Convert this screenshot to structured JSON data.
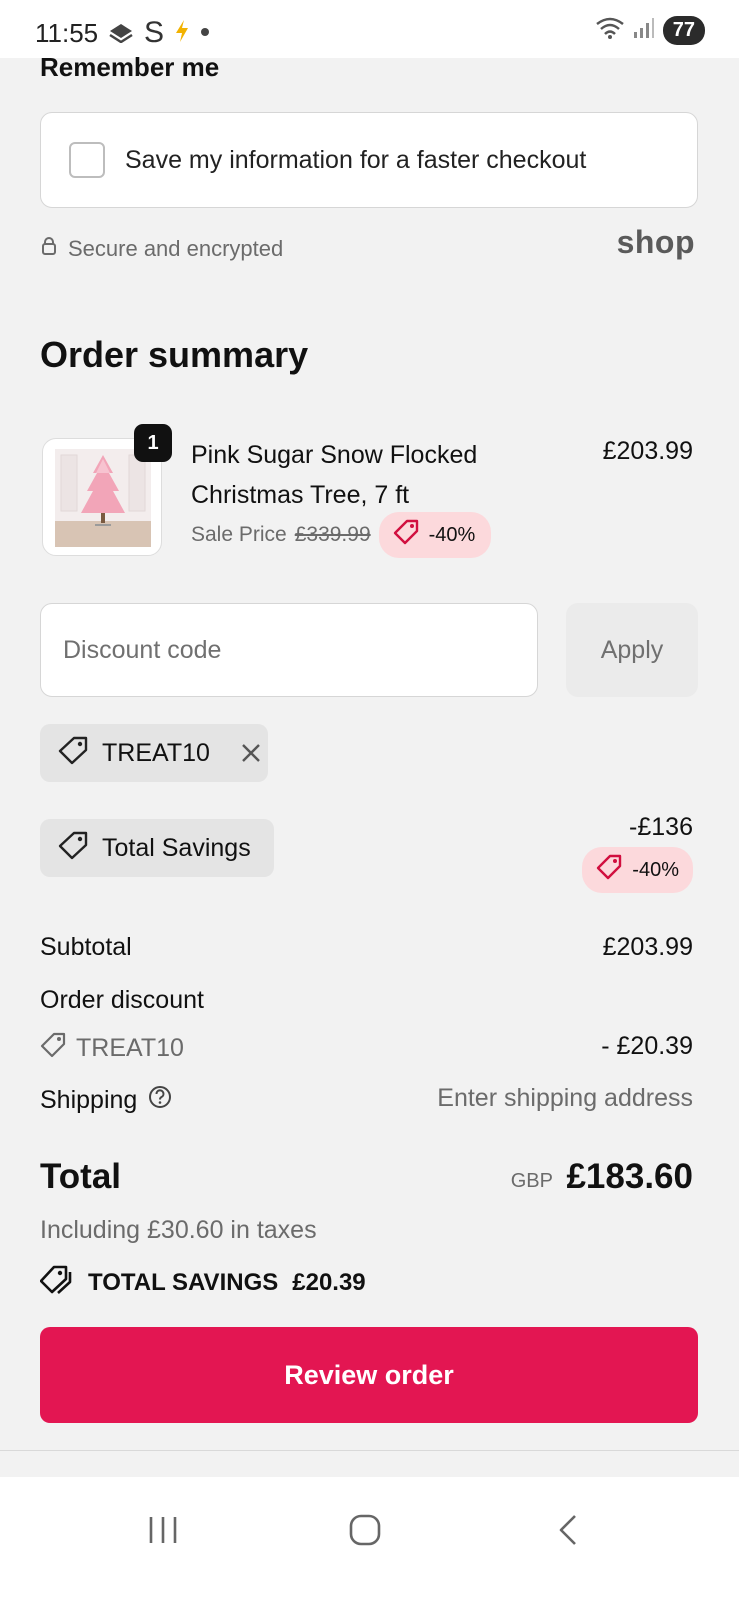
{
  "status_bar": {
    "time": "11:55",
    "s_glyph": "S",
    "battery": "77",
    "left_icons": [
      "stack-icon",
      "s-app-icon",
      "bolt-icon",
      "dot-icon"
    ],
    "right_icons": [
      "wifi-icon",
      "signal-icon",
      "battery-icon"
    ]
  },
  "remember": {
    "title": "Remember me",
    "checkbox_label": "Save my information for a faster checkout",
    "checked": false
  },
  "secure": {
    "text": "Secure and encrypted",
    "shop_logo": "shop"
  },
  "order_summary": {
    "title": "Order summary",
    "product": {
      "quantity": "1",
      "name": "Pink Sugar Snow Flocked Christmas Tree, 7 ft",
      "price": "£203.99",
      "sale_label": "Sale Price",
      "original_price": "£339.99",
      "discount_pct": "-40%"
    },
    "discount": {
      "placeholder": "Discount code",
      "apply_label": "Apply",
      "applied_code": "TREAT10"
    },
    "total_savings_chip": {
      "label": "Total Savings",
      "amount": "-£136",
      "pct": "-40%"
    },
    "lines": {
      "subtotal_label": "Subtotal",
      "subtotal_value": "£203.99",
      "order_discount_label": "Order discount",
      "discount_code": "TREAT10",
      "discount_value": "- £20.39",
      "shipping_label": "Shipping",
      "shipping_value": "Enter shipping address"
    },
    "total": {
      "label": "Total",
      "currency": "GBP",
      "value": "£183.60",
      "taxes": "Including £30.60 in taxes",
      "savings_label": "TOTAL SAVINGS",
      "savings_value": "£20.39"
    },
    "review_button": "Review order"
  },
  "colors": {
    "accent": "#e31652",
    "badge_bg": "#fcd9dc",
    "chip_bg": "#e4e4e4",
    "page_bg": "#f2f2f2"
  },
  "nav_bar": {
    "icons": [
      "recent-apps-icon",
      "home-icon",
      "back-icon"
    ]
  }
}
